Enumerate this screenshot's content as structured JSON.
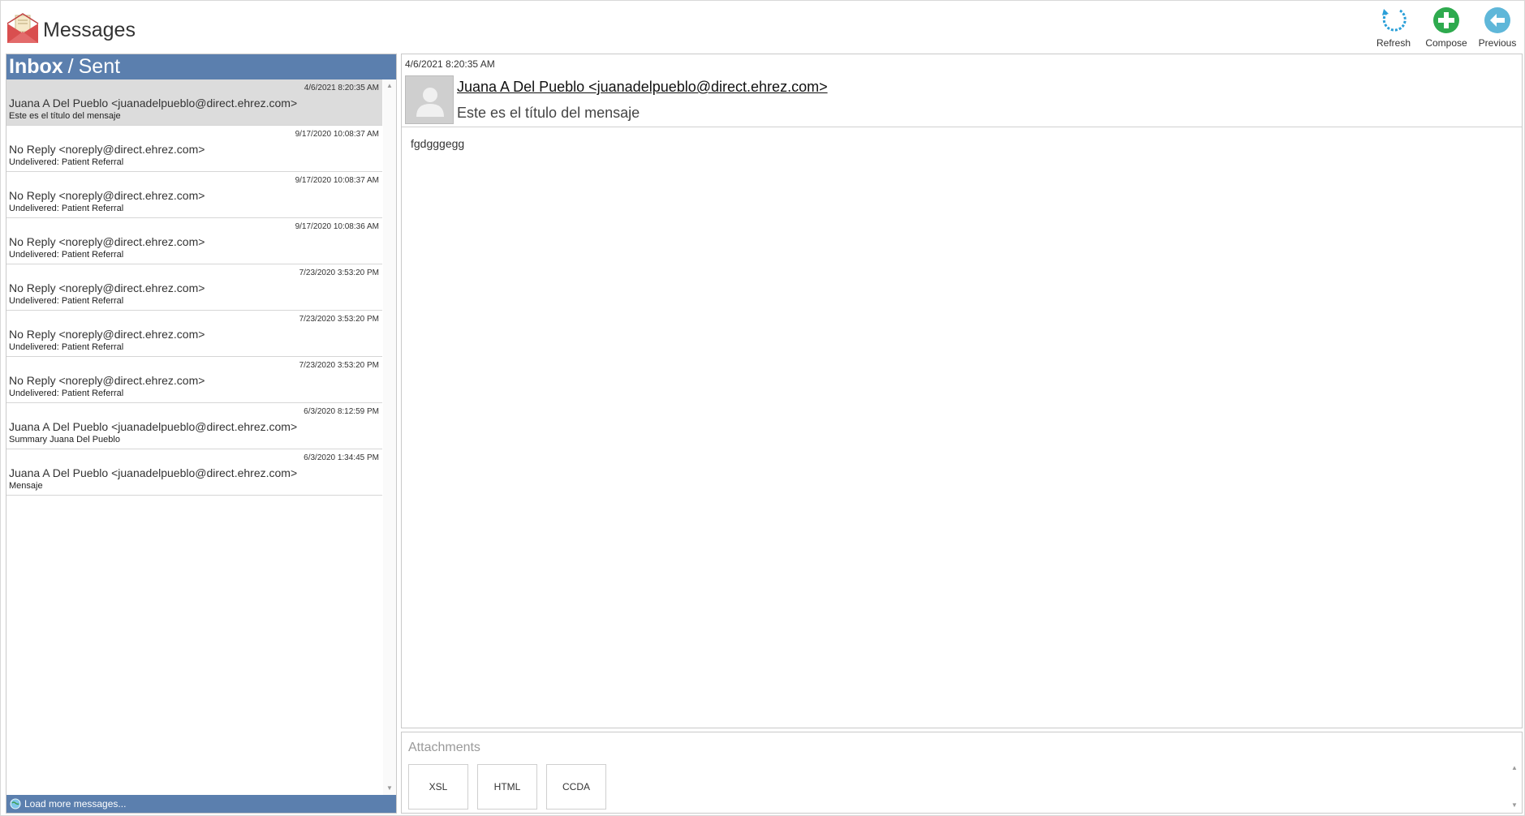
{
  "app": {
    "title": "Messages"
  },
  "toolbar": {
    "refresh_label": "Refresh",
    "compose_label": "Compose",
    "previous_label": "Previous"
  },
  "folders": {
    "inbox": "Inbox",
    "separator": "/",
    "sent": "Sent"
  },
  "messages": [
    {
      "date": "4/6/2021 8:20:35 AM",
      "from": "Juana A Del Pueblo <juanadelpueblo@direct.ehrez.com>",
      "subject": "Este es el título del mensaje",
      "selected": true
    },
    {
      "date": "9/17/2020 10:08:37 AM",
      "from": "No Reply <noreply@direct.ehrez.com>",
      "subject": "Undelivered: Patient Referral"
    },
    {
      "date": "9/17/2020 10:08:37 AM",
      "from": "No Reply <noreply@direct.ehrez.com>",
      "subject": "Undelivered: Patient Referral"
    },
    {
      "date": "9/17/2020 10:08:36 AM",
      "from": "No Reply <noreply@direct.ehrez.com>",
      "subject": "Undelivered: Patient Referral"
    },
    {
      "date": "7/23/2020 3:53:20 PM",
      "from": "No Reply <noreply@direct.ehrez.com>",
      "subject": "Undelivered: Patient Referral"
    },
    {
      "date": "7/23/2020 3:53:20 PM",
      "from": "No Reply <noreply@direct.ehrez.com>",
      "subject": "Undelivered: Patient Referral"
    },
    {
      "date": "7/23/2020 3:53:20 PM",
      "from": "No Reply <noreply@direct.ehrez.com>",
      "subject": "Undelivered: Patient Referral"
    },
    {
      "date": "6/3/2020 8:12:59 PM",
      "from": "Juana A Del Pueblo <juanadelpueblo@direct.ehrez.com>",
      "subject": "Summary Juana Del Pueblo"
    },
    {
      "date": "6/3/2020 1:34:45 PM",
      "from": "Juana A Del Pueblo <juanadelpueblo@direct.ehrez.com>",
      "subject": "Mensaje"
    }
  ],
  "load_more": "Load more messages...",
  "reading_pane": {
    "date": "4/6/2021 8:20:35 AM",
    "from": "Juana A Del Pueblo <juanadelpueblo@direct.ehrez.com>",
    "subject": "Este es el título del mensaje",
    "body": "fgdgggegg"
  },
  "attachments": {
    "title": "Attachments",
    "items": [
      "XSL",
      "HTML",
      "CCDA"
    ]
  },
  "icons": {
    "logo": "envelope-letter-icon",
    "refresh": "refresh-icon",
    "compose": "plus-circle-icon",
    "previous": "arrow-left-circle-icon",
    "avatar": "user-silhouette-icon",
    "load_more": "globe-icon"
  },
  "colors": {
    "panel_header": "#5b7fae",
    "selected_row": "#dcdcdc",
    "refresh": "#2a9fd8",
    "compose": "#2eaa4e",
    "previous": "#5fb7d9",
    "logo_red": "#d94f4f"
  }
}
